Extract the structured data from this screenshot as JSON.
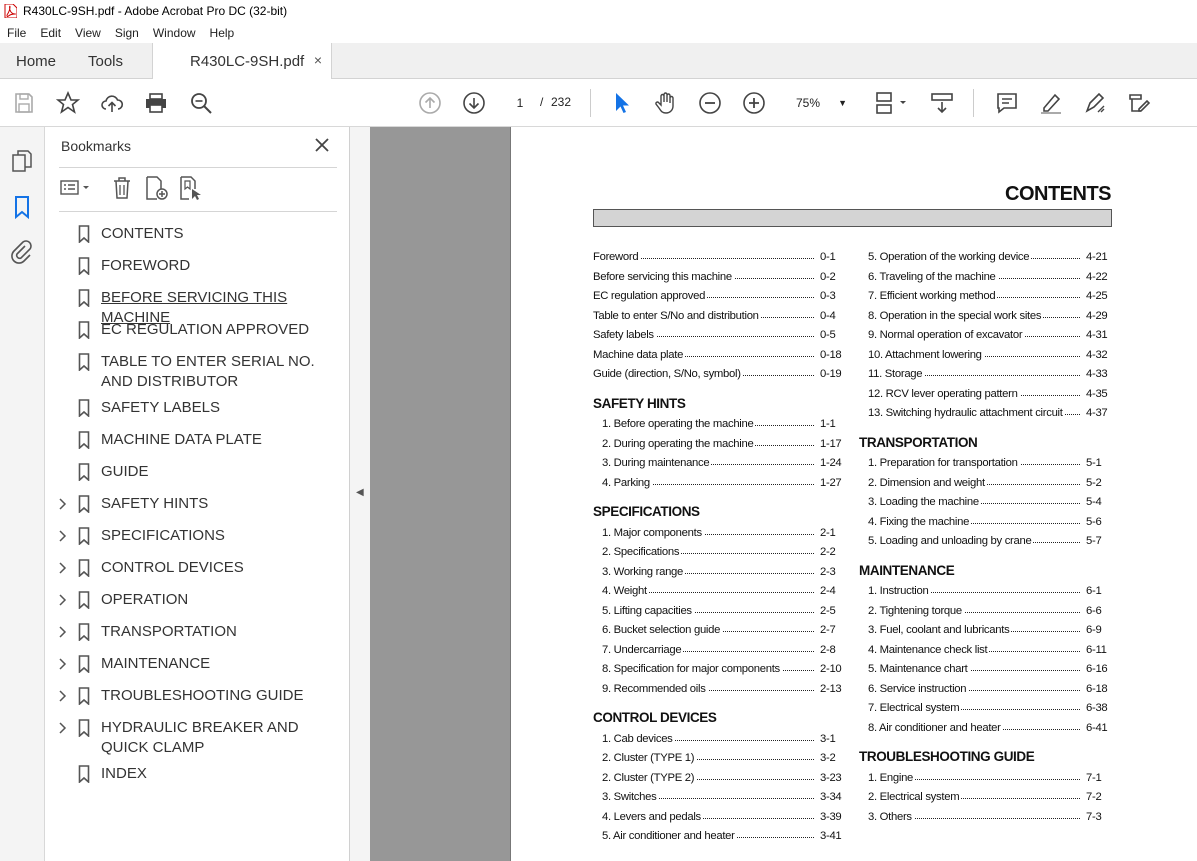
{
  "window": {
    "title": "R430LC-9SH.pdf - Adobe Acrobat Pro DC (32-bit)"
  },
  "menu": [
    "File",
    "Edit",
    "View",
    "Sign",
    "Window",
    "Help"
  ],
  "tabs": {
    "home": "Home",
    "tools": "Tools",
    "doc": "R430LC-9SH.pdf",
    "close": "×"
  },
  "toolbar": {
    "page_current": "1",
    "page_sep": "/",
    "page_total": "232",
    "zoom": "75%"
  },
  "bookmarks": {
    "title": "Bookmarks",
    "items": [
      {
        "label": "CONTENTS",
        "expandable": false
      },
      {
        "label": "FOREWORD",
        "expandable": false
      },
      {
        "label": "BEFORE SERVICING THIS MACHINE",
        "expandable": false
      },
      {
        "label": "EC REGULATION APPROVED",
        "expandable": false
      },
      {
        "label": "TABLE TO ENTER SERIAL NO. AND DISTRIBUTOR",
        "expandable": false
      },
      {
        "label": "SAFETY LABELS",
        "expandable": false
      },
      {
        "label": "MACHINE DATA PLATE",
        "expandable": false
      },
      {
        "label": "GUIDE",
        "expandable": false
      },
      {
        "label": "SAFETY HINTS",
        "expandable": true
      },
      {
        "label": "SPECIFICATIONS",
        "expandable": true
      },
      {
        "label": "CONTROL DEVICES",
        "expandable": true
      },
      {
        "label": "OPERATION",
        "expandable": true
      },
      {
        "label": "TRANSPORTATION",
        "expandable": true
      },
      {
        "label": "MAINTENANCE",
        "expandable": true
      },
      {
        "label": "TROUBLESHOOTING GUIDE",
        "expandable": true
      },
      {
        "label": "HYDRAULIC BREAKER AND QUICK CLAMP",
        "expandable": true
      },
      {
        "label": "INDEX",
        "expandable": false
      }
    ]
  },
  "document": {
    "title": "CONTENTS",
    "left": [
      {
        "type": "entry",
        "text": "Foreword",
        "page": "0-1"
      },
      {
        "type": "entry",
        "text": "Before servicing this machine",
        "page": "0-2"
      },
      {
        "type": "entry",
        "text": "EC regulation approved",
        "page": "0-3"
      },
      {
        "type": "entry",
        "text": "Table to enter S/No and distribution",
        "page": "0-4"
      },
      {
        "type": "entry",
        "text": "Safety labels",
        "page": "0-5"
      },
      {
        "type": "entry",
        "text": "Machine data plate",
        "page": "0-18"
      },
      {
        "type": "entry",
        "text": "Guide (direction, S/No, symbol)",
        "page": "0-19"
      },
      {
        "type": "section",
        "text": "SAFETY HINTS"
      },
      {
        "type": "entry",
        "text": "1. Before operating the machine",
        "page": "1-1"
      },
      {
        "type": "entry",
        "text": "2. During operating the machine",
        "page": "1-17"
      },
      {
        "type": "entry",
        "text": "3. During maintenance",
        "page": "1-24"
      },
      {
        "type": "entry",
        "text": "4. Parking",
        "page": "1-27"
      },
      {
        "type": "section",
        "text": "SPECIFICATIONS"
      },
      {
        "type": "entry",
        "text": "1. Major components",
        "page": "2-1"
      },
      {
        "type": "entry",
        "text": "2. Specifications",
        "page": "2-2"
      },
      {
        "type": "entry",
        "text": "3. Working range",
        "page": "2-3"
      },
      {
        "type": "entry",
        "text": "4. Weight",
        "page": "2-4"
      },
      {
        "type": "entry",
        "text": "5. Lifting capacities",
        "page": "2-5"
      },
      {
        "type": "entry",
        "text": "6. Bucket selection guide",
        "page": "2-7"
      },
      {
        "type": "entry",
        "text": "7. Undercarriage",
        "page": "2-8"
      },
      {
        "type": "entry",
        "text": "8. Specification for major components",
        "page": "2-10"
      },
      {
        "type": "entry",
        "text": "9. Recommended oils",
        "page": "2-13"
      },
      {
        "type": "section",
        "text": "CONTROL DEVICES"
      },
      {
        "type": "entry",
        "text": "1. Cab devices",
        "page": "3-1"
      },
      {
        "type": "entry",
        "text": "2. Cluster (TYPE 1)",
        "page": "3-2"
      },
      {
        "type": "entry",
        "text": "2. Cluster (TYPE 2)",
        "page": "3-23"
      },
      {
        "type": "entry",
        "text": "3. Switches",
        "page": "3-34"
      },
      {
        "type": "entry",
        "text": "4. Levers and pedals",
        "page": "3-39"
      },
      {
        "type": "entry",
        "text": "5. Air conditioner and heater",
        "page": "3-41"
      }
    ],
    "right": [
      {
        "type": "entry",
        "text": "5. Operation of the working device",
        "page": "4-21"
      },
      {
        "type": "entry",
        "text": "6. Traveling of the machine",
        "page": "4-22"
      },
      {
        "type": "entry",
        "text": "7. Efficient working method",
        "page": "4-25"
      },
      {
        "type": "entry",
        "text": "8. Operation in the special work sites",
        "page": "4-29"
      },
      {
        "type": "entry",
        "text": "9. Normal operation of excavator",
        "page": "4-31"
      },
      {
        "type": "entry",
        "text": "10. Attachment lowering",
        "page": "4-32"
      },
      {
        "type": "entry",
        "text": "11. Storage",
        "page": "4-33"
      },
      {
        "type": "entry",
        "text": "12. RCV lever operating pattern",
        "page": "4-35"
      },
      {
        "type": "entry",
        "text": "13. Switching hydraulic attachment circuit",
        "page": "4-37"
      },
      {
        "type": "section",
        "text": "TRANSPORTATION"
      },
      {
        "type": "entry",
        "text": "1. Preparation for transportation",
        "page": "5-1"
      },
      {
        "type": "entry",
        "text": "2. Dimension and weight",
        "page": "5-2"
      },
      {
        "type": "entry",
        "text": "3. Loading the machine",
        "page": "5-4"
      },
      {
        "type": "entry",
        "text": "4. Fixing the machine",
        "page": "5-6"
      },
      {
        "type": "entry",
        "text": "5. Loading and unloading by crane",
        "page": "5-7"
      },
      {
        "type": "section",
        "text": "MAINTENANCE"
      },
      {
        "type": "entry",
        "text": "1. Instruction",
        "page": "6-1"
      },
      {
        "type": "entry",
        "text": "2. Tightening torque",
        "page": "6-6"
      },
      {
        "type": "entry",
        "text": "3. Fuel, coolant and lubricants",
        "page": "6-9"
      },
      {
        "type": "entry",
        "text": "4. Maintenance check list",
        "page": "6-11"
      },
      {
        "type": "entry",
        "text": "5. Maintenance chart",
        "page": "6-16"
      },
      {
        "type": "entry",
        "text": "6. Service instruction",
        "page": "6-18"
      },
      {
        "type": "entry",
        "text": "7. Electrical system",
        "page": "6-38"
      },
      {
        "type": "entry",
        "text": "8. Air conditioner and heater",
        "page": "6-41"
      },
      {
        "type": "section",
        "text": "TROUBLESHOOTING GUIDE"
      },
      {
        "type": "entry",
        "text": "1. Engine",
        "page": "7-1"
      },
      {
        "type": "entry",
        "text": "2. Electrical system",
        "page": "7-2"
      },
      {
        "type": "entry",
        "text": "3. Others",
        "page": "7-3"
      }
    ]
  },
  "colors": {
    "accent": "#1473e6",
    "toolbar_bg": "#f0f0f0",
    "viewer_bg": "#979797"
  }
}
